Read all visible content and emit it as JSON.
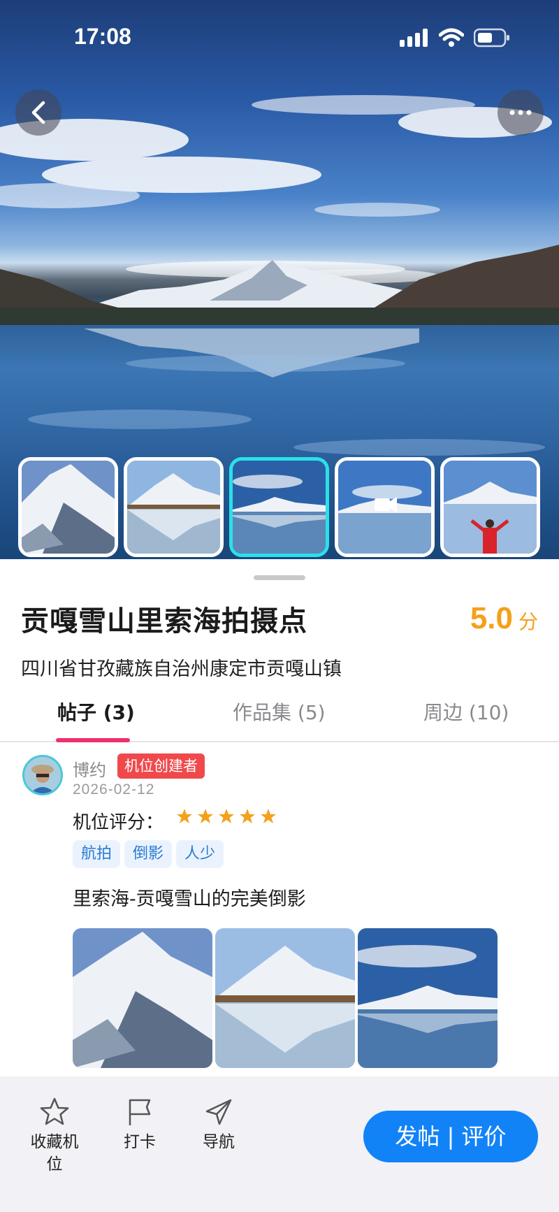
{
  "status_bar": {
    "time": "17:08",
    "icons": [
      "signal-icon",
      "wifi-icon",
      "battery-icon"
    ]
  },
  "header": {
    "back_icon": "back-chevron-icon",
    "more_icon": "more-dots-icon"
  },
  "gallery": {
    "thumbnails": [
      {
        "name": "snow-peak-closeup"
      },
      {
        "name": "mountain-reflection"
      },
      {
        "name": "lake-wide",
        "selected": true
      },
      {
        "name": "video-lake",
        "video": true
      },
      {
        "name": "person-arms-raised"
      }
    ]
  },
  "spot": {
    "title": "贡嘎雪山里索海拍摄点",
    "score": "5.0",
    "score_unit": "分",
    "address": "四川省甘孜藏族自治州康定市贡嘎山镇"
  },
  "tabs": [
    {
      "label": "帖子 (3)",
      "active": true
    },
    {
      "label": "作品集 (5)",
      "active": false
    },
    {
      "label": "周边 (10)",
      "active": false
    }
  ],
  "post": {
    "author": "博约",
    "badge": "机位创建者",
    "date": "2026-02-12",
    "rating_label": "机位评分：",
    "rating": 5,
    "tags": [
      "航拍",
      "倒影",
      "人少"
    ],
    "text": "里索海-贡嘎雪山的完美倒影",
    "images": [
      "snow-peak",
      "peak-reflection",
      "lake-panorama"
    ]
  },
  "bottom_bar": {
    "favorite_label": "收藏机位",
    "checkin_label": "打卡",
    "navigate_label": "导航",
    "post_button": "发帖 | 评价"
  },
  "colors": {
    "accent": "#1283f7",
    "score": "#f5a01a",
    "tab_indicator": "#f0306d",
    "badge": "#f0494c",
    "thumb_selected": "#2be0e8"
  }
}
